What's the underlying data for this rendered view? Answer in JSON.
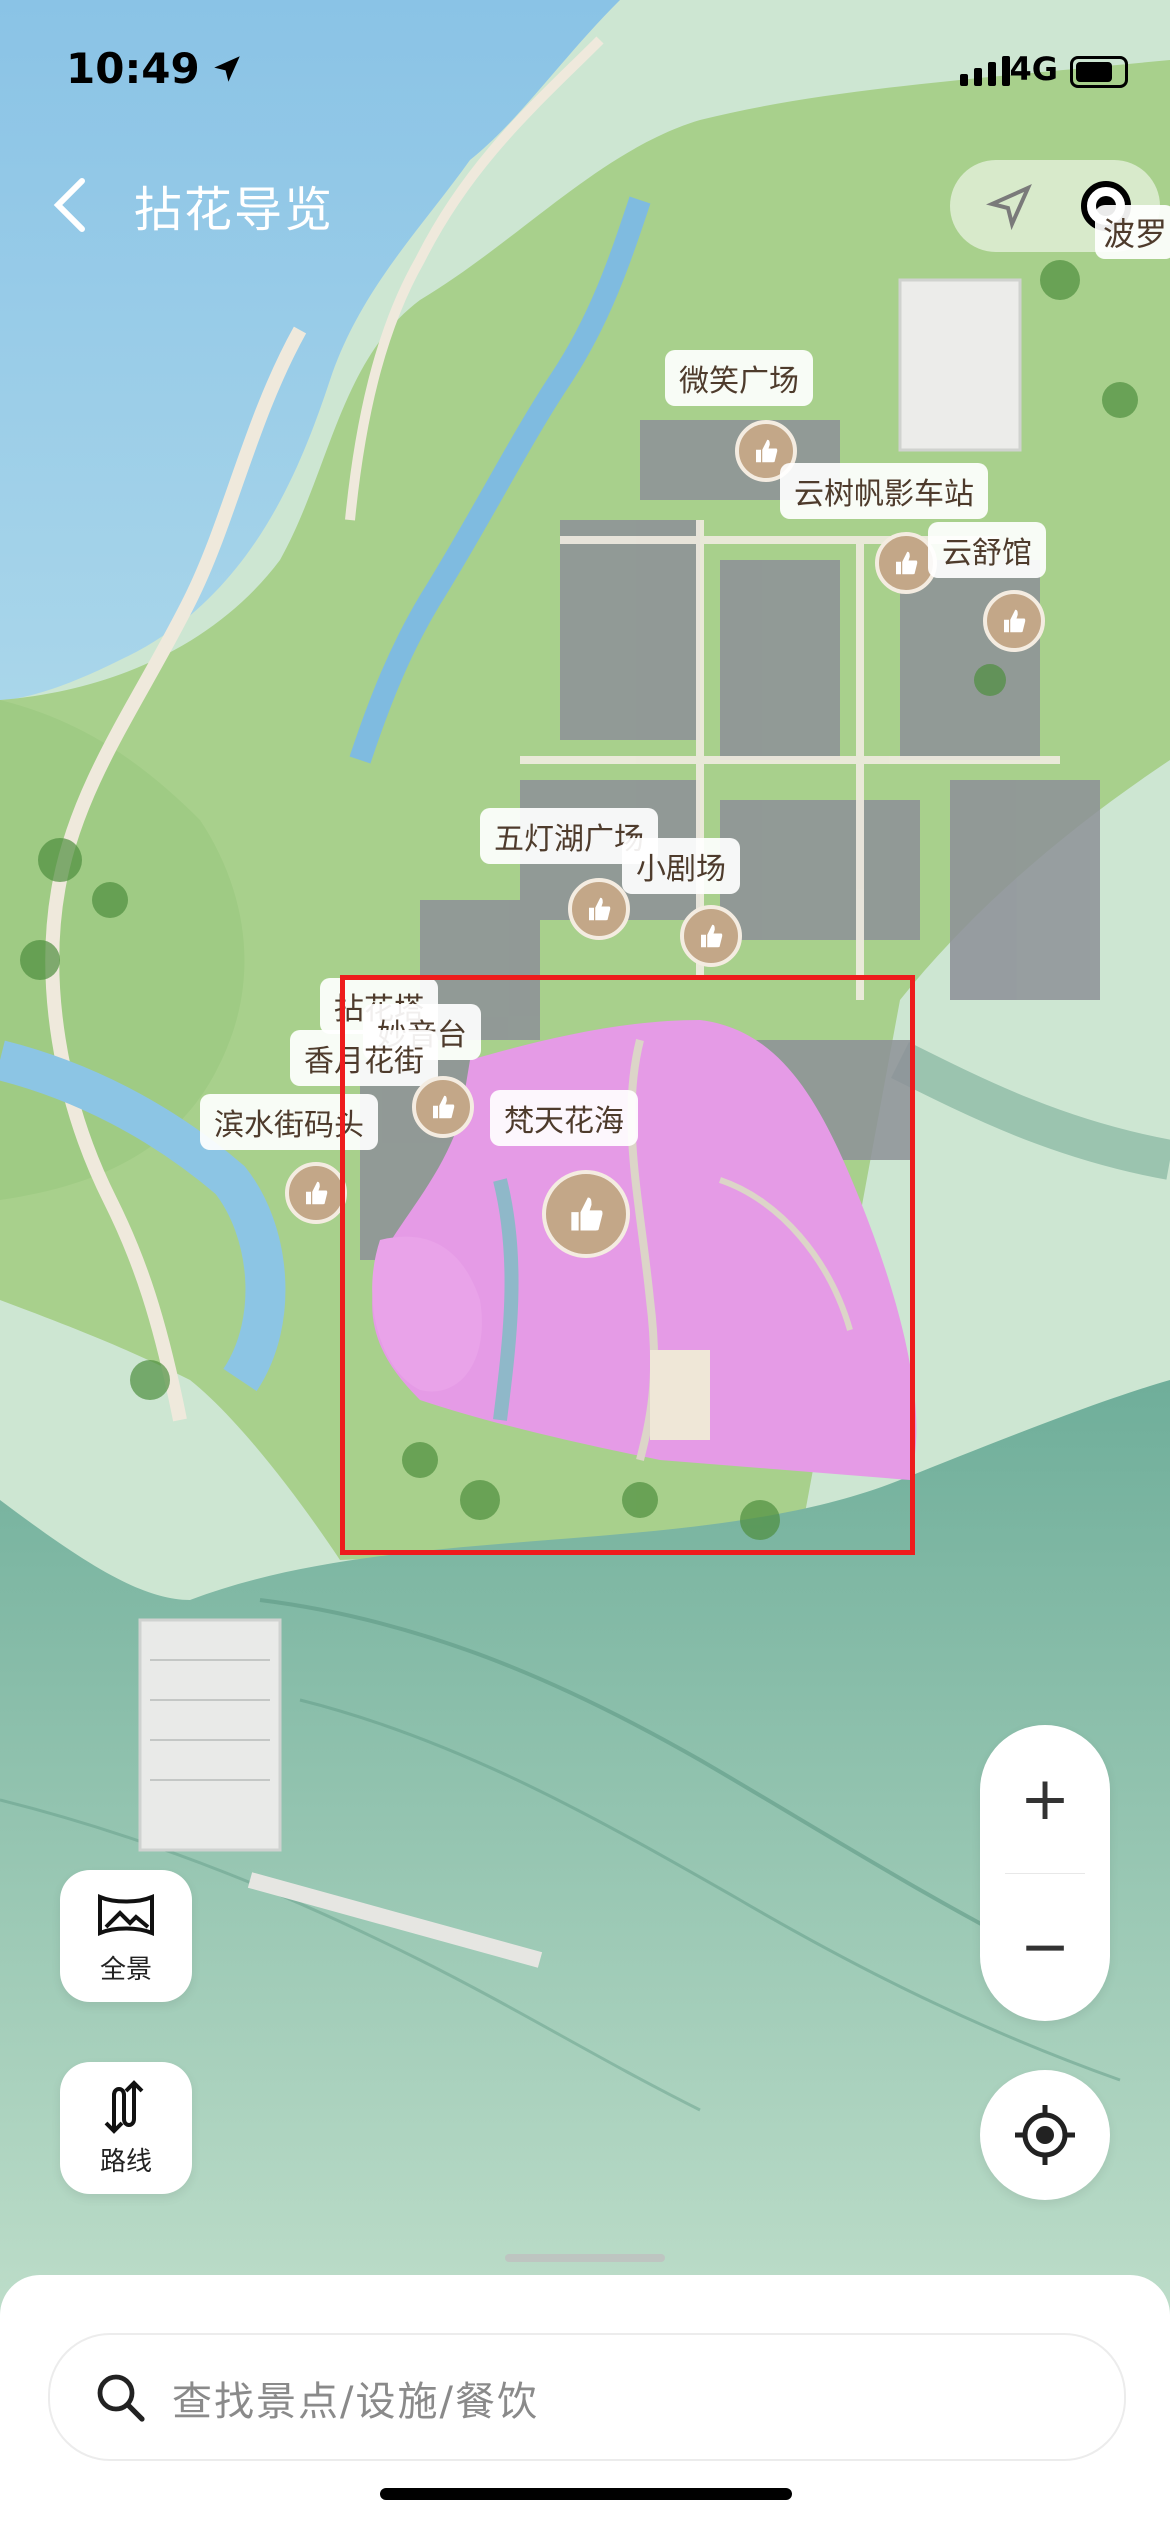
{
  "status_bar": {
    "time": "10:49",
    "network": "4G"
  },
  "header": {
    "title": "拈花导览",
    "edge_label": "波罗"
  },
  "map": {
    "labels": [
      {
        "id": "weixiao",
        "text": "微笑广场"
      },
      {
        "id": "yunshu",
        "text": "云树帆影车站"
      },
      {
        "id": "yunshu_guan",
        "text": "云舒馆"
      },
      {
        "id": "wudenghu",
        "text": "五灯湖广场"
      },
      {
        "id": "xiaojuchang",
        "text": "小剧场"
      },
      {
        "id": "nianhuata",
        "text": "拈花塔"
      },
      {
        "id": "miaoyintai",
        "text": "妙音台"
      },
      {
        "id": "xiangyuehuajie",
        "text": "香月花街"
      },
      {
        "id": "binshuijie",
        "text": "滨水街码头"
      },
      {
        "id": "fantianhuahai",
        "text": "梵天花海"
      }
    ]
  },
  "controls": {
    "panorama_label": "全景",
    "route_label": "路线",
    "zoom_in": "+",
    "zoom_out": "−"
  },
  "search": {
    "placeholder": "查找景点/设施/餐饮"
  },
  "colors": {
    "highlight": "#ee1c1c",
    "flower_field": "#e59be6",
    "water": "#8fc6e8",
    "land": "#9fcf86"
  }
}
